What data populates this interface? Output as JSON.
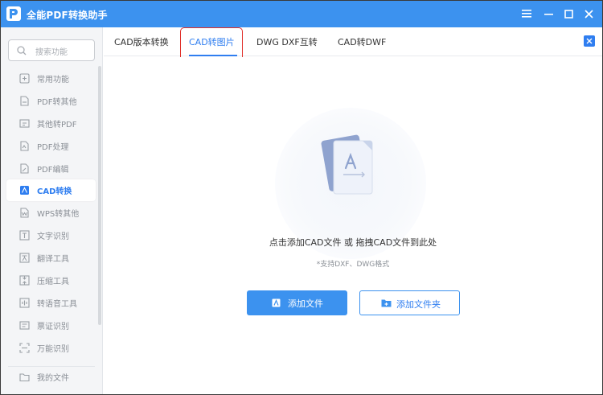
{
  "app": {
    "title": "全能PDF转换助手"
  },
  "sidebar": {
    "search_placeholder": "搜索功能",
    "items": [
      {
        "label": "常用功能",
        "icon": "star-icon"
      },
      {
        "label": "PDF转其他",
        "icon": "pdf-convert-icon"
      },
      {
        "label": "其他转PDF",
        "icon": "to-pdf-icon"
      },
      {
        "label": "PDF处理",
        "icon": "pdf-process-icon"
      },
      {
        "label": "PDF编辑",
        "icon": "pdf-edit-icon"
      },
      {
        "label": "CAD转换",
        "icon": "cad-icon",
        "active": true
      },
      {
        "label": "WPS转其他",
        "icon": "wps-icon"
      },
      {
        "label": "文字识别",
        "icon": "ocr-icon"
      },
      {
        "label": "翻译工具",
        "icon": "translate-icon"
      },
      {
        "label": "压缩工具",
        "icon": "compress-icon"
      },
      {
        "label": "转语音工具",
        "icon": "speech-icon"
      },
      {
        "label": "票证识别",
        "icon": "ticket-icon"
      },
      {
        "label": "万能识别",
        "icon": "scan-icon"
      }
    ],
    "footer_item": {
      "label": "我的文件",
      "icon": "folder-icon"
    }
  },
  "tabs": [
    {
      "label": "CAD版本转换"
    },
    {
      "label": "CAD转图片",
      "active": true
    },
    {
      "label": "DWG DXF互转"
    },
    {
      "label": "CAD转DWF"
    }
  ],
  "main": {
    "hint": "点击添加CAD文件 或 拖拽CAD文件到此处",
    "formats": "*支持DXF、DWG格式",
    "add_file_label": "添加文件",
    "add_folder_label": "添加文件夹"
  },
  "colors": {
    "accent": "#3c92ef",
    "active_text": "#2f7ef0",
    "highlight": "#e0302a"
  }
}
